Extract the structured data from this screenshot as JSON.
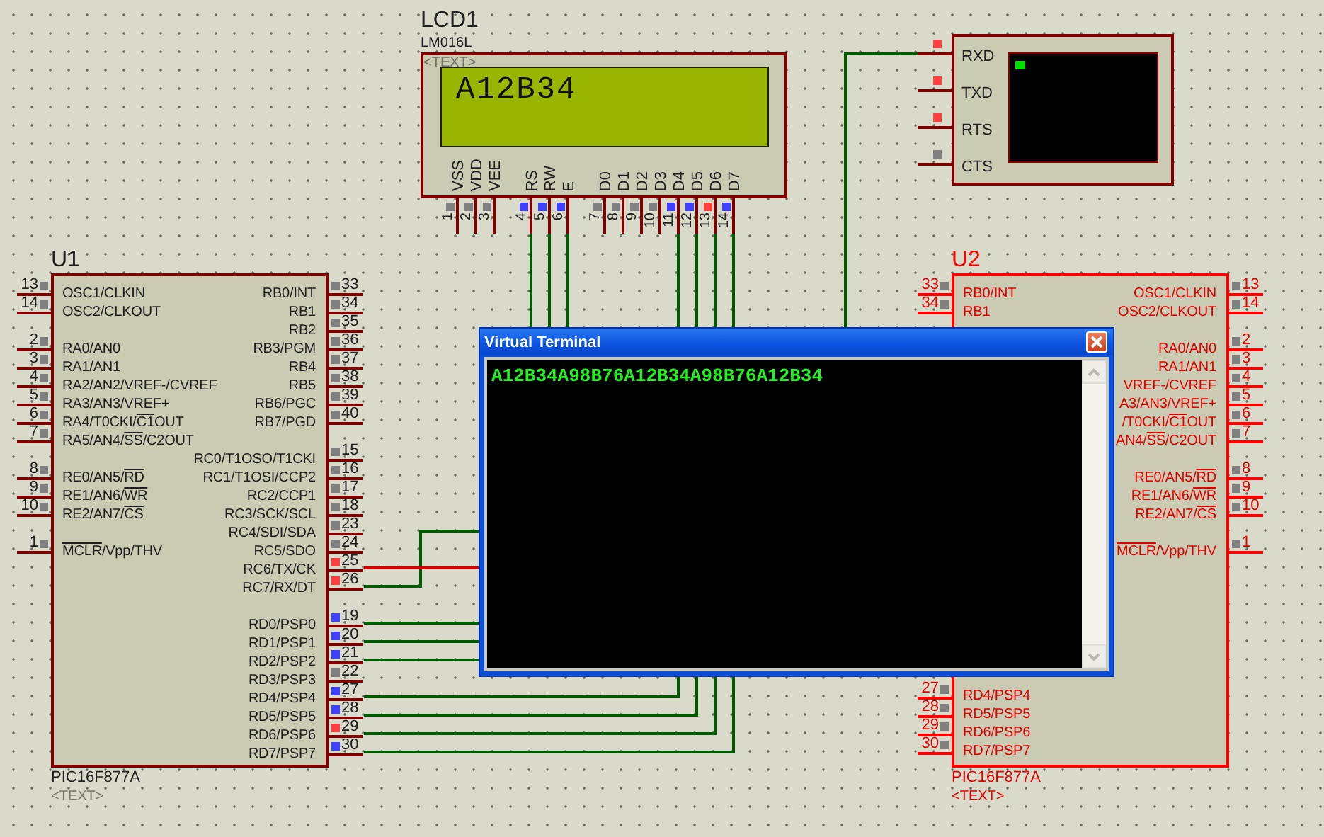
{
  "schematic": {
    "lcd": {
      "ref": "LCD1",
      "part": "LM016L",
      "text": "<TEXT>",
      "display": "A12B34",
      "pin_groups": [
        [
          {
            "number": "1",
            "name": "VSS",
            "color": "#808080"
          },
          {
            "number": "2",
            "name": "VDD",
            "color": "#808080"
          },
          {
            "number": "3",
            "name": "VEE",
            "color": "#808080"
          }
        ],
        [
          {
            "number": "4",
            "name": "RS",
            "color": "#4040ff"
          },
          {
            "number": "5",
            "name": "RW",
            "color": "#4040ff"
          },
          {
            "number": "6",
            "name": "E",
            "color": "#4040ff"
          }
        ],
        [
          {
            "number": "7",
            "name": "D0",
            "color": "#808080"
          },
          {
            "number": "8",
            "name": "D1",
            "color": "#808080"
          },
          {
            "number": "9",
            "name": "D2",
            "color": "#808080"
          },
          {
            "number": "10",
            "name": "D3",
            "color": "#808080"
          },
          {
            "number": "11",
            "name": "D4",
            "color": "#4040ff"
          },
          {
            "number": "12",
            "name": "D5",
            "color": "#4040ff"
          },
          {
            "number": "13",
            "name": "D6",
            "color": "#ff4040"
          },
          {
            "number": "14",
            "name": "D7",
            "color": "#4040ff"
          }
        ]
      ]
    },
    "serial_terminal": {
      "pins": [
        {
          "name": "RXD",
          "color": "#ff4040"
        },
        {
          "name": "TXD",
          "color": "#ff4040"
        },
        {
          "name": "RTS",
          "color": "#ff4040"
        },
        {
          "name": "CTS",
          "color": "#808080"
        }
      ]
    },
    "chips": [
      {
        "ref": "U1",
        "part": "PIC16F877A",
        "text": "<TEXT>",
        "selected": false,
        "left": {
          "top": [
            [
              {
                "number": "13",
                "label": "OSC1/CLKIN",
                "color": "#808080"
              },
              {
                "number": "14",
                "label": "OSC2/CLKOUT",
                "color": "#808080"
              }
            ],
            [
              {
                "number": "2",
                "label": "RA0/AN0",
                "color": "#808080"
              },
              {
                "number": "3",
                "label": "RA1/AN1",
                "color": "#808080"
              },
              {
                "number": "4",
                "label": "RA2/AN2/VREF-/CVREF",
                "color": "#808080"
              },
              {
                "number": "5",
                "label": "RA3/AN3/VREF+",
                "color": "#808080"
              },
              {
                "number": "6",
                "label": [
                  {
                    "text": "RA4/T0CKI/"
                  },
                  {
                    "text": "C1",
                    "overline": true
                  },
                  {
                    "text": "OUT"
                  }
                ],
                "color": "#808080"
              },
              {
                "number": "7",
                "label": [
                  {
                    "text": "RA5/AN4/"
                  },
                  {
                    "text": "SS",
                    "overline": true
                  },
                  {
                    "text": "/C2OUT"
                  }
                ],
                "color": "#808080"
              }
            ],
            [
              {
                "number": "8",
                "label": [
                  {
                    "text": "RE0/AN5/"
                  },
                  {
                    "text": "RD",
                    "overline": true
                  }
                ],
                "color": "#808080"
              },
              {
                "number": "9",
                "label": [
                  {
                    "text": "RE1/AN6/"
                  },
                  {
                    "text": "WR",
                    "overline": true
                  }
                ],
                "color": "#808080"
              },
              {
                "number": "10",
                "label": [
                  {
                    "text": "RE2/AN7/"
                  },
                  {
                    "text": "CS",
                    "overline": true
                  }
                ],
                "color": "#808080"
              }
            ],
            [
              {
                "number": "1",
                "label": [
                  {
                    "text": "MCLR",
                    "overline": true
                  },
                  {
                    "text": "/Vpp/THV"
                  }
                ],
                "color": "#808080"
              }
            ]
          ]
        },
        "right": {
          "top": [
            [
              {
                "number": "33",
                "label": "RB0/INT",
                "color": "#808080"
              },
              {
                "number": "34",
                "label": "RB1",
                "color": "#808080"
              },
              {
                "number": "35",
                "label": "RB2",
                "color": "#808080"
              },
              {
                "number": "36",
                "label": "RB3/PGM",
                "color": "#808080"
              },
              {
                "number": "37",
                "label": "RB4",
                "color": "#808080"
              },
              {
                "number": "38",
                "label": "RB5",
                "color": "#808080"
              },
              {
                "number": "39",
                "label": "RB6/PGC",
                "color": "#808080"
              },
              {
                "number": "40",
                "label": "RB7/PGD",
                "color": "#808080"
              }
            ],
            [
              {
                "number": "15",
                "label": "RC0/T1OSO/T1CKI",
                "color": "#808080"
              },
              {
                "number": "16",
                "label": "RC1/T1OSI/CCP2",
                "color": "#808080"
              },
              {
                "number": "17",
                "label": "RC2/CCP1",
                "color": "#808080"
              },
              {
                "number": "18",
                "label": "RC3/SCK/SCL",
                "color": "#808080"
              },
              {
                "number": "23",
                "label": "RC4/SDI/SDA",
                "color": "#808080"
              },
              {
                "number": "24",
                "label": "RC5/SDO",
                "color": "#808080"
              },
              {
                "number": "25",
                "label": "RC6/TX/CK",
                "color": "#ff4040"
              },
              {
                "number": "26",
                "label": "RC7/RX/DT",
                "color": "#ff4040"
              }
            ]
          ],
          "bottom": [
            [
              {
                "number": "19",
                "label": "RD0/PSP0",
                "color": "#4040ff"
              },
              {
                "number": "20",
                "label": "RD1/PSP1",
                "color": "#4040ff"
              },
              {
                "number": "21",
                "label": "RD2/PSP2",
                "color": "#4040ff"
              },
              {
                "number": "22",
                "label": "RD3/PSP3",
                "color": "#808080"
              },
              {
                "number": "27",
                "label": "RD4/PSP4",
                "color": "#4040ff"
              },
              {
                "number": "28",
                "label": "RD5/PSP5",
                "color": "#4040ff"
              },
              {
                "number": "29",
                "label": "RD6/PSP6",
                "color": "#ff4040"
              },
              {
                "number": "30",
                "label": "RD7/PSP7",
                "color": "#4040ff"
              }
            ]
          ]
        }
      },
      {
        "ref": "U2",
        "part": "PIC16F877A",
        "text": "<TEXT>",
        "selected": true,
        "left": {
          "top": [
            [
              {
                "number": "33",
                "label": "RB0/INT",
                "color": "#808080"
              },
              {
                "number": "34",
                "label": "RB1",
                "color": "#808080"
              }
            ]
          ],
          "bottom": [
            [
              {
                "number": "27",
                "label": "RD4/PSP4",
                "color": "#808080"
              },
              {
                "number": "28",
                "label": "RD5/PSP5",
                "color": "#808080"
              },
              {
                "number": "29",
                "label": "RD6/PSP6",
                "color": "#808080"
              },
              {
                "number": "30",
                "label": "RD7/PSP7",
                "color": "#808080"
              }
            ]
          ]
        },
        "right": {
          "top": [
            [
              {
                "number": "13",
                "label": "OSC1/CLKIN",
                "color": "#808080"
              },
              {
                "number": "14",
                "label": "OSC2/CLKOUT",
                "color": "#808080"
              }
            ],
            [
              {
                "number": "2",
                "label": "RA0/AN0",
                "color": "#808080"
              },
              {
                "number": "3",
                "label": "RA1/AN1",
                "color": "#808080"
              },
              {
                "number": "4",
                "label": "VREF-/CVREF",
                "color": "#808080"
              },
              {
                "number": "5",
                "label": "A3/AN3/VREF+",
                "color": "#808080"
              },
              {
                "number": "6",
                "label": [
                  {
                    "text": "/T0CKI/"
                  },
                  {
                    "text": "C1",
                    "overline": true
                  },
                  {
                    "text": "OUT"
                  }
                ],
                "color": "#808080"
              },
              {
                "number": "7",
                "label": [
                  {
                    "text": "AN4/"
                  },
                  {
                    "text": "SS",
                    "overline": true
                  },
                  {
                    "text": "/C2OUT"
                  }
                ],
                "color": "#808080"
              }
            ],
            [
              {
                "number": "8",
                "label": [
                  {
                    "text": "RE0/AN5/"
                  },
                  {
                    "text": "RD",
                    "overline": true
                  }
                ],
                "color": "#808080"
              },
              {
                "number": "9",
                "label": [
                  {
                    "text": "RE1/AN6/"
                  },
                  {
                    "text": "WR",
                    "overline": true
                  }
                ],
                "color": "#808080"
              },
              {
                "number": "10",
                "label": [
                  {
                    "text": "RE2/AN7/"
                  },
                  {
                    "text": "CS",
                    "overline": true
                  }
                ],
                "color": "#808080"
              }
            ],
            [
              {
                "number": "1",
                "label": [
                  {
                    "text": "MCLR",
                    "overline": true
                  },
                  {
                    "text": "/Vpp/THV"
                  }
                ],
                "color": "#808080"
              }
            ]
          ]
        }
      }
    ]
  },
  "terminal_window": {
    "title": "Virtual Terminal",
    "output": "A12B34A98B76A12B34A98B76A12B34"
  }
}
